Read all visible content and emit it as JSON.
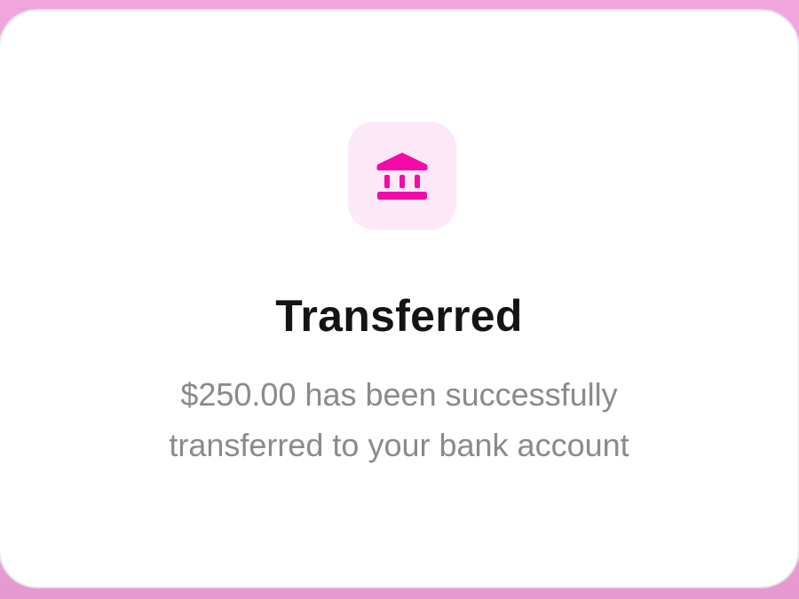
{
  "dialog": {
    "icon": "bank-icon",
    "title": "Transferred",
    "message_line1": "$250.00 has been successfully",
    "message_line2": "transferred to your bank account"
  },
  "colors": {
    "background": "#f0a6dc",
    "card": "#ffffff",
    "accent": "#f40aa8",
    "icon_tile": "#fde8f8",
    "title": "#141414",
    "message": "#8a8a8e"
  }
}
